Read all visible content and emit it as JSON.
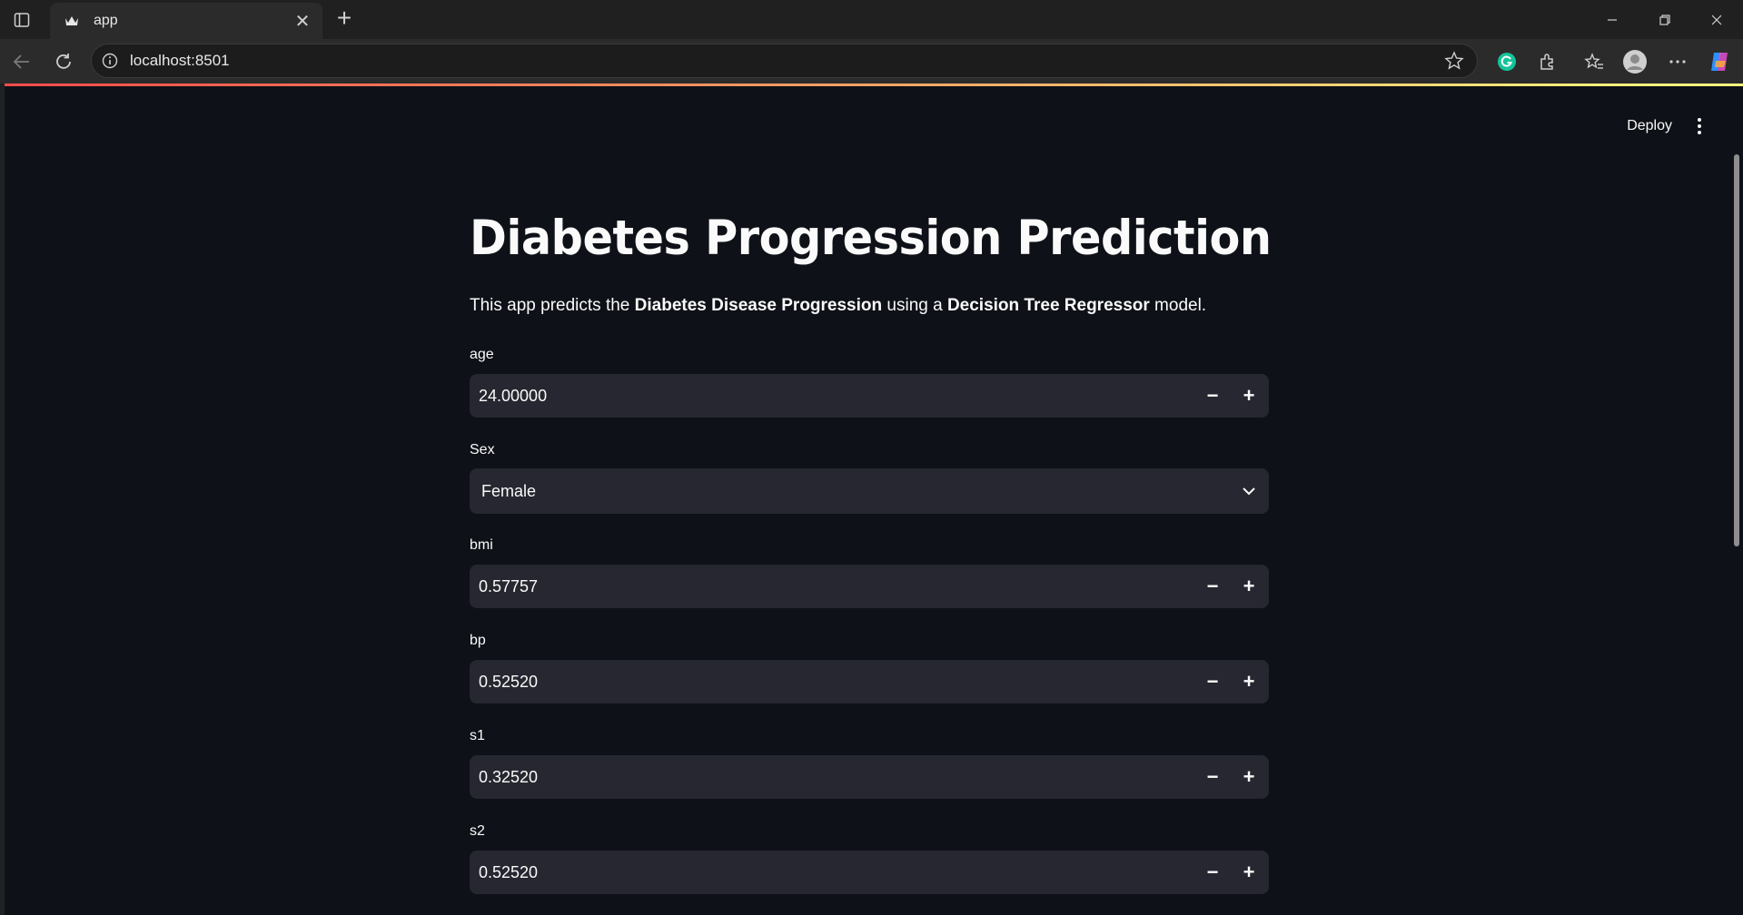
{
  "browser": {
    "tab_title": "app",
    "url": "localhost:8501"
  },
  "header": {
    "deploy_label": "Deploy"
  },
  "main": {
    "title": "Diabetes Progression Prediction",
    "description": {
      "pre": "This app predicts the ",
      "bold1": "Diabetes Disease Progression",
      "mid": " using a ",
      "bold2": "Decision Tree Regressor",
      "post": " model."
    },
    "fields": {
      "age": {
        "label": "age",
        "value": "24.00000"
      },
      "sex": {
        "label": "Sex",
        "value": "Female"
      },
      "bmi": {
        "label": "bmi",
        "value": "0.57757"
      },
      "bp": {
        "label": "bp",
        "value": "0.52520"
      },
      "s1": {
        "label": "s1",
        "value": "0.32520"
      },
      "s2": {
        "label": "s2",
        "value": "0.52520"
      }
    },
    "stepper_minus": "−",
    "stepper_plus": "+"
  },
  "colors": {
    "app_bg": "#0e1117",
    "input_bg": "#262730",
    "accent_gradient_start": "#ff4b4b",
    "accent_gradient_end": "#fffd80"
  }
}
